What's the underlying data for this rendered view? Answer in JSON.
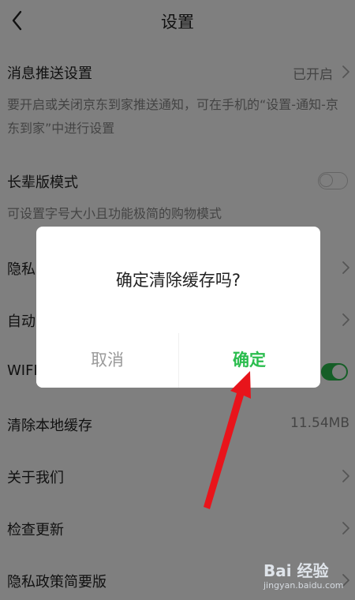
{
  "header": {
    "title": "设置"
  },
  "settings": {
    "push": {
      "label": "消息推送设置",
      "value": "已开启",
      "desc": "要开启或关闭京东到家推送通知，可在手机的“设置-通知-京东到家”中进行设置"
    },
    "elder": {
      "label": "长辈版模式",
      "desc": "可设置字号大小且功能极简的购物模式",
      "enabled": false
    },
    "privacy": {
      "label": "隐私"
    },
    "auto": {
      "label": "自动"
    },
    "wifi": {
      "label": "WIFI",
      "enabled": true
    },
    "cache": {
      "label": "清除本地缓存",
      "value": "11.54MB"
    },
    "about": {
      "label": "关于我们"
    },
    "update": {
      "label": "检查更新"
    },
    "policy": {
      "label": "隐私政策简要版"
    }
  },
  "dialog": {
    "message": "确定清除缓存吗?",
    "cancel_label": "取消",
    "confirm_label": "确定"
  },
  "watermark": {
    "logo": "Bai 经验",
    "url": "jingyan.baidu.com"
  },
  "colors": {
    "accent_green": "#2bbd4e",
    "annotation_red": "#e8141b",
    "overlay": "rgba(0,0,0,0.5)"
  }
}
